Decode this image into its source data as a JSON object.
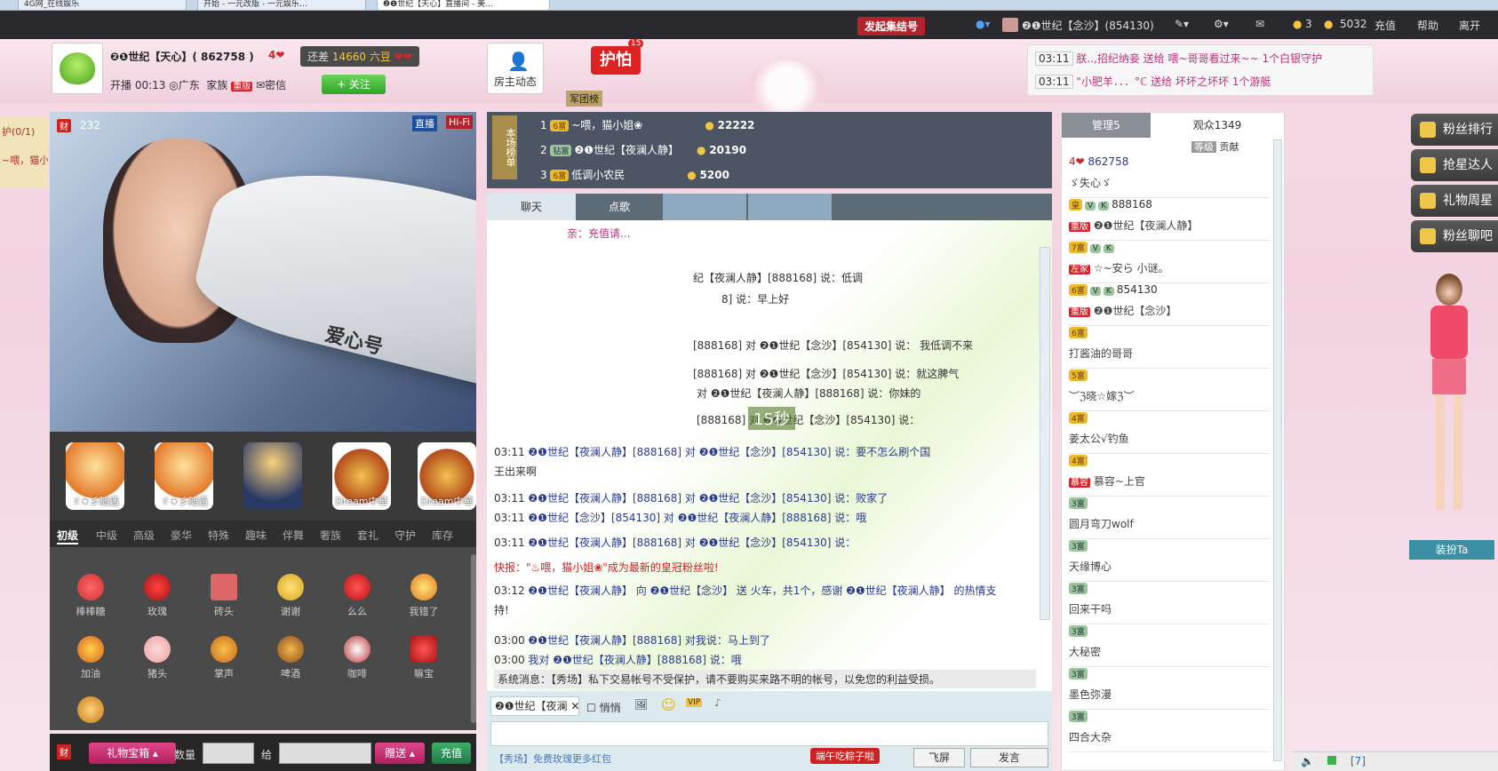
{
  "browser_tabs": [
    "4G网_在线娱乐",
    "开始 - 一元改版 - 一元娱乐…",
    "❷❶世纪【天心】直播间 - 美…"
  ],
  "topbar": {
    "collect_button": "发起集结号",
    "user": "❷❶世纪【念沙】(854130)",
    "coins1": "3",
    "coins2": "5032",
    "recharge": "充值",
    "help": "帮助",
    "exit": "离开"
  },
  "host": {
    "name": "❷❶世纪【天心】( 862758 )",
    "level_badge": "4",
    "diff_label": "还差",
    "diff_value": "14660 六豆",
    "online_time": "开播 00:13",
    "location": "广东",
    "family_label": "家族",
    "family_tag": "重版",
    "message": "密信",
    "follow": "+ 关注",
    "dynamic": "房主动态",
    "guard": "护怕",
    "guard_count": "15",
    "guard_rank": "军团榜"
  },
  "notices": [
    {
      "time": "03:11",
      "text": "朕..,招纪纳妾 送给 喂~哥哥看过来~~ 1个白银守护"
    },
    {
      "time": "03:11",
      "text": "\"小肥羊．．．°ℂ 送给 坏坏之坏坏 1个游艇"
    }
  ],
  "left_edge": {
    "guard": "护(0/1)",
    "text": "~喂，猫小"
  },
  "video": {
    "live": "直播",
    "hifi": "Hi-Fi",
    "wealth": "232",
    "train_text": "爱心号",
    "timer": "15秒"
  },
  "big_gifts": [
    "ゞ★彡随遇",
    "ゞ★彡随遇",
    "",
    "Dream中華",
    "Dream中華"
  ],
  "gift_tabs": [
    "初级",
    "中级",
    "高级",
    "豪华",
    "特殊",
    "趣味",
    "伴舞",
    "奢族",
    "套礼",
    "守护",
    "库存"
  ],
  "gifts": [
    "棒棒糖",
    "玫瑰",
    "砖头",
    "谢谢",
    "么么",
    "我错了",
    "加油",
    "猪头",
    "掌声",
    "啤酒",
    "咖啡",
    "嘛宝"
  ],
  "send": {
    "box": "礼物宝箱",
    "qty": "数量",
    "to": "给",
    "give": "赠送",
    "recharge": "充值"
  },
  "rank": [
    {
      "no": "1",
      "tag": "6富",
      "name": "~喂，猫小姐❀",
      "value": "22222"
    },
    {
      "no": "2",
      "tag": "钻富",
      "name": "❷❶世纪【夜澜人静】",
      "value": "20190"
    },
    {
      "no": "3",
      "tag": "6富",
      "name": "低调小农民",
      "value": "5200"
    }
  ],
  "rank_label": "本场榜单",
  "chat_tabs": [
    "聊天",
    "点歌",
    "",
    ""
  ],
  "chat": [
    {
      "time": "",
      "text": "亲：充值请..."
    },
    {
      "time": "",
      "text": "纪【夜澜人静】[888168] 说：低调"
    },
    {
      "time": "",
      "text": "8] 说：早上好"
    },
    {
      "time": "",
      "text": "[888168] 对 ❷❶世纪【念沙】[854130] 说： 我低调不来"
    },
    {
      "time": "",
      "text": "[888168] 对 ❷❶世纪【念沙】[854130] 说：就这脾气"
    },
    {
      "time": "",
      "text": "对 ❷❶世纪【夜澜人静】[888168] 说：你妹的"
    },
    {
      "time": "",
      "text": "[888168] 对 ❷❶世纪【念沙】[854130] 说："
    },
    {
      "time": "03:11",
      "text": "❷❶世纪【夜澜人静】[888168] 对 ❷❶世纪【念沙】[854130] 说：要不怎么刷个国"
    },
    {
      "time": "",
      "text": "王出来啊"
    },
    {
      "time": "03:11",
      "text": "❷❶世纪【夜澜人静】[888168] 对 ❷❶世纪【念沙】[854130] 说：败家了"
    },
    {
      "time": "03:11",
      "text": "❷❶世纪【念沙】[854130] 对 ❷❶世纪【夜澜人静】[888168] 说：哦"
    },
    {
      "time": "03:11",
      "text": "❷❶世纪【夜澜人静】[888168] 对 ❷❶世纪【念沙】[854130] 说："
    },
    {
      "time": "",
      "text": "快报：\"♨喂，猫小姐❀\"成为最新的皇冠粉丝啦!"
    },
    {
      "time": "03:12",
      "text": "❷❶世纪【夜澜人静】 向 ❷❶世纪【念沙】 送 火车，共1个，感谢 ❷❶世纪【夜澜人静】 的热情支"
    },
    {
      "time": "",
      "text": "持!"
    },
    {
      "time": "03:00",
      "text": "❷❶世纪【夜澜人静】[888168] 对我说：马上到了"
    },
    {
      "time": "03:00",
      "text": "我对 ❷❶世纪【夜澜人静】[888168] 说：哦"
    },
    {
      "time": "",
      "text": "系统消息：【秀场】私下交易帐号不受保护，请不要购买来路不明的帐号，以免您的利益受损。"
    }
  ],
  "chat_input": {
    "target": "❷❶世纪【夜澜",
    "whisper": "悄悄",
    "hint": "【秀场】免费玫瑰更多红包",
    "promo": "端午吃粽子啦",
    "fly": "飞屏",
    "send": "发言"
  },
  "user_tabs": {
    "admin": "管理5",
    "audience": "观众1349",
    "sort1": "等级",
    "sort2": "贡献"
  },
  "users": [
    {
      "id": "862758",
      "name": "ゞ失心ゞ"
    },
    {
      "id": "888168",
      "name": "❷❶世纪【夜澜人静】"
    },
    {
      "id": "",
      "name": "☆~安ら 小谜。"
    },
    {
      "id": "854130",
      "name": "❷❶世纪【念沙】"
    },
    {
      "id": "",
      "name": "打酱油的哥哥"
    },
    {
      "id": "",
      "name": "︶ℨ晓☆嫁ℨ︶"
    },
    {
      "id": "",
      "name": "姜太公√钓鱼"
    },
    {
      "id": "",
      "name": "慕容~上官"
    },
    {
      "id": "",
      "name": "圆月弯刀wolf"
    },
    {
      "id": "",
      "name": "天缘博心"
    },
    {
      "id": "",
      "name": "回来干吗"
    },
    {
      "id": "",
      "name": "大秘密"
    },
    {
      "id": "",
      "name": "墨色弥漫"
    },
    {
      "id": "",
      "name": "四合大杂"
    }
  ],
  "side_menu": [
    "粉丝排行",
    "抢星达人",
    "礼物周星",
    "粉丝聊吧"
  ],
  "dress": "装扮Ta",
  "status": {
    "count": "[7]"
  }
}
